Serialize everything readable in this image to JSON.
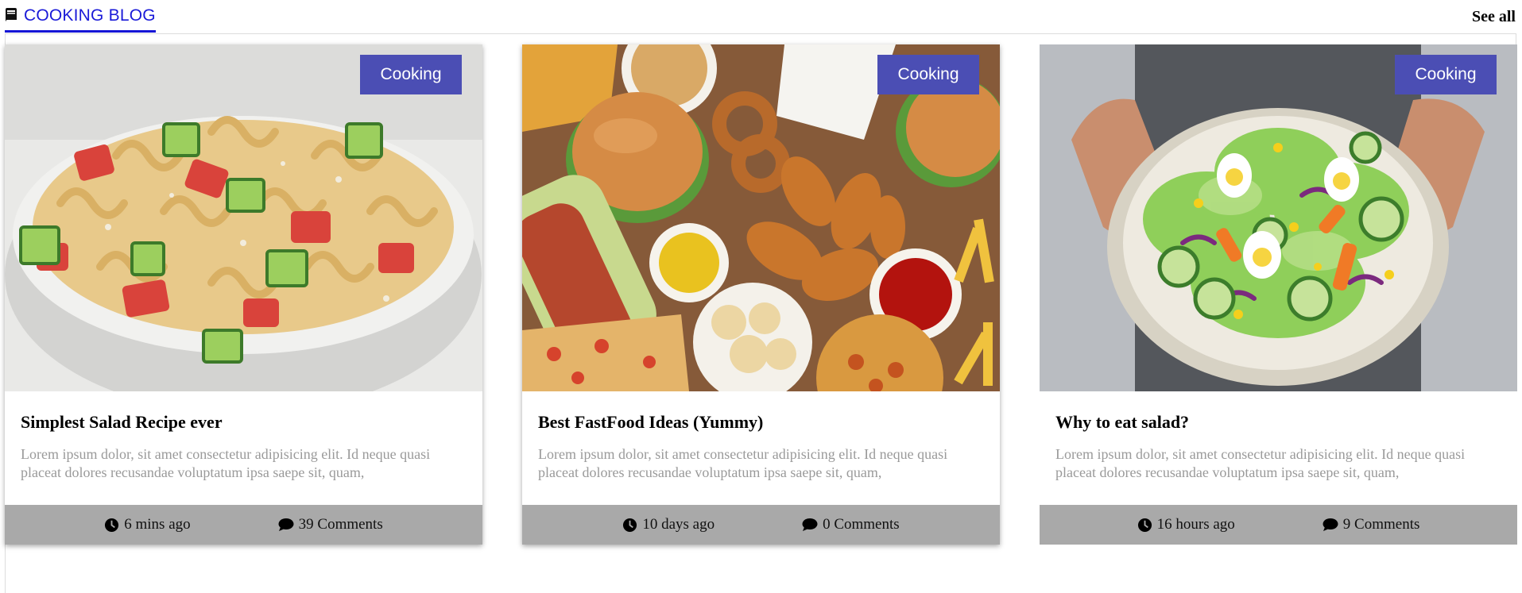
{
  "header": {
    "icon": "book-icon",
    "title": "COOKING BLOG",
    "see_all": "See all",
    "accent": "#1a1ad8"
  },
  "cards": [
    {
      "badge": "Cooking",
      "title": "Simplest Salad Recipe ever",
      "excerpt": "Lorem ipsum dolor, sit amet consectetur adipisicing elit. Id neque quasi placeat dolores recusandae voluptatum ipsa saepe sit, quam,",
      "time": "6 mins ago",
      "comments": "39 Comments",
      "image": "pasta-salad-bowl"
    },
    {
      "badge": "Cooking",
      "title": "Best FastFood Ideas (Yummy)",
      "excerpt": "Lorem ipsum dolor, sit amet consectetur adipisicing elit. Id neque quasi placeat dolores recusandae voluptatum ipsa saepe sit, quam,",
      "time": "10 days ago",
      "comments": "0 Comments",
      "image": "fast-food-spread"
    },
    {
      "badge": "Cooking",
      "title": "Why to eat salad?",
      "excerpt": "Lorem ipsum dolor, sit amet consectetur adipisicing elit. Id neque quasi placeat dolores recusandae voluptatum ipsa saepe sit, quam,",
      "time": "16 hours ago",
      "comments": "9 Comments",
      "image": "green-salad-plate"
    }
  ],
  "colors": {
    "badge_bg": "#4b4eb4",
    "footer_bg": "#a9a9a9",
    "excerpt_text": "#9a9a9a"
  },
  "icons": {
    "time": "clock-icon",
    "comments": "comment-icon"
  }
}
